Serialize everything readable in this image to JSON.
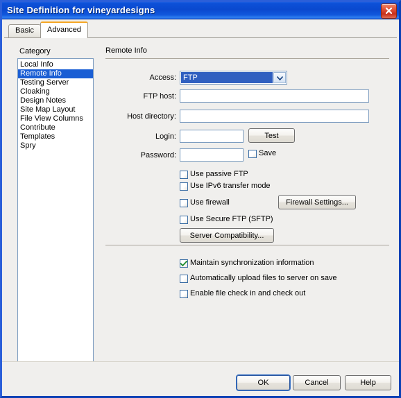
{
  "window": {
    "title": "Site Definition for vineyardesigns",
    "close_icon": "close-x-icon"
  },
  "tabs": [
    {
      "label": "Basic",
      "active": false
    },
    {
      "label": "Advanced",
      "active": true
    }
  ],
  "sidebar": {
    "heading": "Category",
    "items": [
      {
        "label": "Local Info",
        "selected": false
      },
      {
        "label": "Remote Info",
        "selected": true
      },
      {
        "label": "Testing Server",
        "selected": false
      },
      {
        "label": "Cloaking",
        "selected": false
      },
      {
        "label": "Design Notes",
        "selected": false
      },
      {
        "label": "Site Map Layout",
        "selected": false
      },
      {
        "label": "File View Columns",
        "selected": false
      },
      {
        "label": "Contribute",
        "selected": false
      },
      {
        "label": "Templates",
        "selected": false
      },
      {
        "label": "Spry",
        "selected": false
      }
    ]
  },
  "main": {
    "section_title": "Remote Info",
    "fields": {
      "access_label": "Access:",
      "access_value": "FTP",
      "access_arrow_icon": "chevron-down-icon",
      "ftp_host_label": "FTP host:",
      "ftp_host_value": "",
      "host_directory_label": "Host directory:",
      "host_directory_value": "",
      "login_label": "Login:",
      "login_value": "",
      "password_label": "Password:",
      "password_value": ""
    },
    "buttons": {
      "test": "Test",
      "firewall_settings": "Firewall Settings...",
      "server_compatibility": "Server Compatibility..."
    },
    "checkboxes": {
      "save": {
        "label": "Save",
        "checked": false
      },
      "use_passive_ftp": {
        "label": "Use passive FTP",
        "checked": false
      },
      "use_ipv6": {
        "label": "Use IPv6 transfer mode",
        "checked": false
      },
      "use_firewall": {
        "label": "Use firewall",
        "checked": false
      },
      "use_sftp": {
        "label": "Use Secure FTP (SFTP)",
        "checked": false
      },
      "maintain_sync": {
        "label": "Maintain synchronization information",
        "checked": true
      },
      "auto_upload": {
        "label": "Automatically upload files to server on save",
        "checked": false
      },
      "check_in_out": {
        "label": "Enable file check in and check out",
        "checked": false
      }
    }
  },
  "footer": {
    "ok": "OK",
    "cancel": "Cancel",
    "help": "Help"
  },
  "colors": {
    "titlebar_blue": "#0a49cf",
    "selection_blue": "#1a5ed4",
    "combo_selection_blue": "#2f5fc0",
    "active_tab_accent": "#f5a623",
    "panel_bg": "#f0efed",
    "field_border": "#7d9dc0",
    "check_green": "#1a8a2a",
    "close_red": "#c8301c"
  }
}
